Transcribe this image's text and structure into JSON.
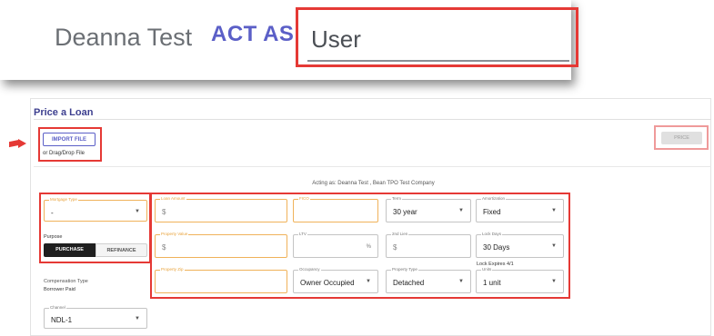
{
  "callout": {
    "user_name": "Deanna Test",
    "act_as_label": "ACT AS",
    "act_as_value": "User"
  },
  "page": {
    "title": "Price a Loan",
    "import_button": "IMPORT FILE",
    "drag_drop_text": "or Drag/Drop File",
    "price_button": "PRICE",
    "acting_as": "Acting as: Deanna Test , Bean TPO Test Company"
  },
  "left": {
    "mortgage_type": {
      "label": "Mortgage Type",
      "value": "-"
    },
    "purpose_label": "Purpose",
    "purpose_options": [
      "PURCHASE",
      "REFINANCE"
    ],
    "purpose_selected": "PURCHASE",
    "compensation_label": "Compensation Type",
    "compensation_value": "Borrower Paid",
    "channel": {
      "label": "Channel",
      "value": "NDL-1"
    }
  },
  "form": {
    "loan_amount": {
      "label": "Loan Amount",
      "value": "$"
    },
    "fico": {
      "label": "FICO",
      "value": ""
    },
    "term": {
      "label": "Term",
      "value": "30 year"
    },
    "amortization": {
      "label": "Amortization",
      "value": "Fixed"
    },
    "property_value": {
      "label": "Property Value",
      "value": "$"
    },
    "ltv": {
      "label": "LTV",
      "value": "",
      "suffix": "%"
    },
    "second_lien": {
      "label": "2nd Lien",
      "value": "$"
    },
    "lock_days": {
      "label": "Lock Days",
      "value": "30 Days"
    },
    "lock_expires": "Lock Expires 4/1",
    "property_zip": {
      "label": "Property Zip",
      "value": ""
    },
    "occupancy": {
      "label": "Occupancy",
      "value": "Owner Occupied"
    },
    "property_type": {
      "label": "Property Type",
      "value": "Detached"
    },
    "units": {
      "label": "Units",
      "value": "1 unit"
    }
  },
  "colors": {
    "accent": "#5b5fc7",
    "highlight": "#e53935",
    "required": "#f0b25a"
  }
}
